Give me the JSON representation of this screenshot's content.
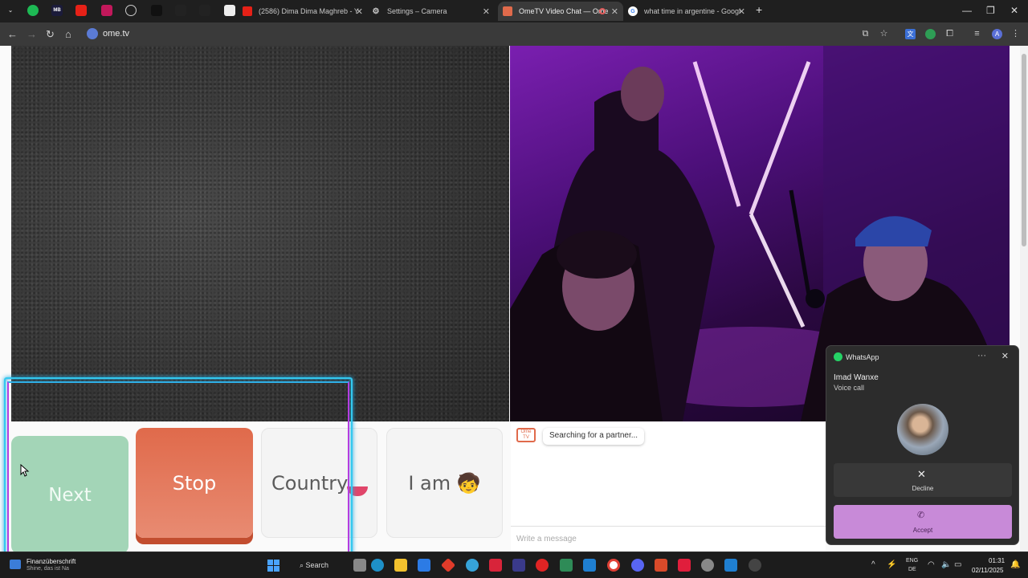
{
  "browser": {
    "tabs": [
      {
        "title": "(2586) Dima Dima Maghreb - Y",
        "favicon_color": "#e62117"
      },
      {
        "title": "Settings – Camera",
        "favicon_color": "#9aa0a6"
      },
      {
        "title": "OmeTV Video Chat — Ome",
        "favicon_color": "#e06a4b"
      },
      {
        "title": "what time in argentine - Googl",
        "favicon_color": "#4285f4"
      }
    ],
    "pinned_labels": [
      "",
      "MB",
      "",
      "",
      "",
      "",
      "",
      "",
      ""
    ],
    "new_tab": "+",
    "url": "ome.tv",
    "profile_initial": "A"
  },
  "page": {
    "controls": {
      "next": "Next",
      "stop": "Stop",
      "country": "Country",
      "iam": "I am 🧒"
    },
    "chat": {
      "logo": "Ome TV",
      "status": "Searching for a partner...",
      "placeholder": "Write a message"
    }
  },
  "whatsapp_call": {
    "app_name": "WhatsApp",
    "menu": "···",
    "caller": "Imad Wanxe",
    "call_type": "Voice call",
    "decline_label": "Decline",
    "accept_label": "Accept",
    "accent": "#c88ad8"
  },
  "taskbar": {
    "weather_title": "Finanzüberschrift",
    "weather_sub": "Shine, das ist Na",
    "search_label": "Search",
    "lang_line1": "ENG",
    "lang_line2": "DE",
    "time": "01:31",
    "date": "02/11/2025"
  }
}
